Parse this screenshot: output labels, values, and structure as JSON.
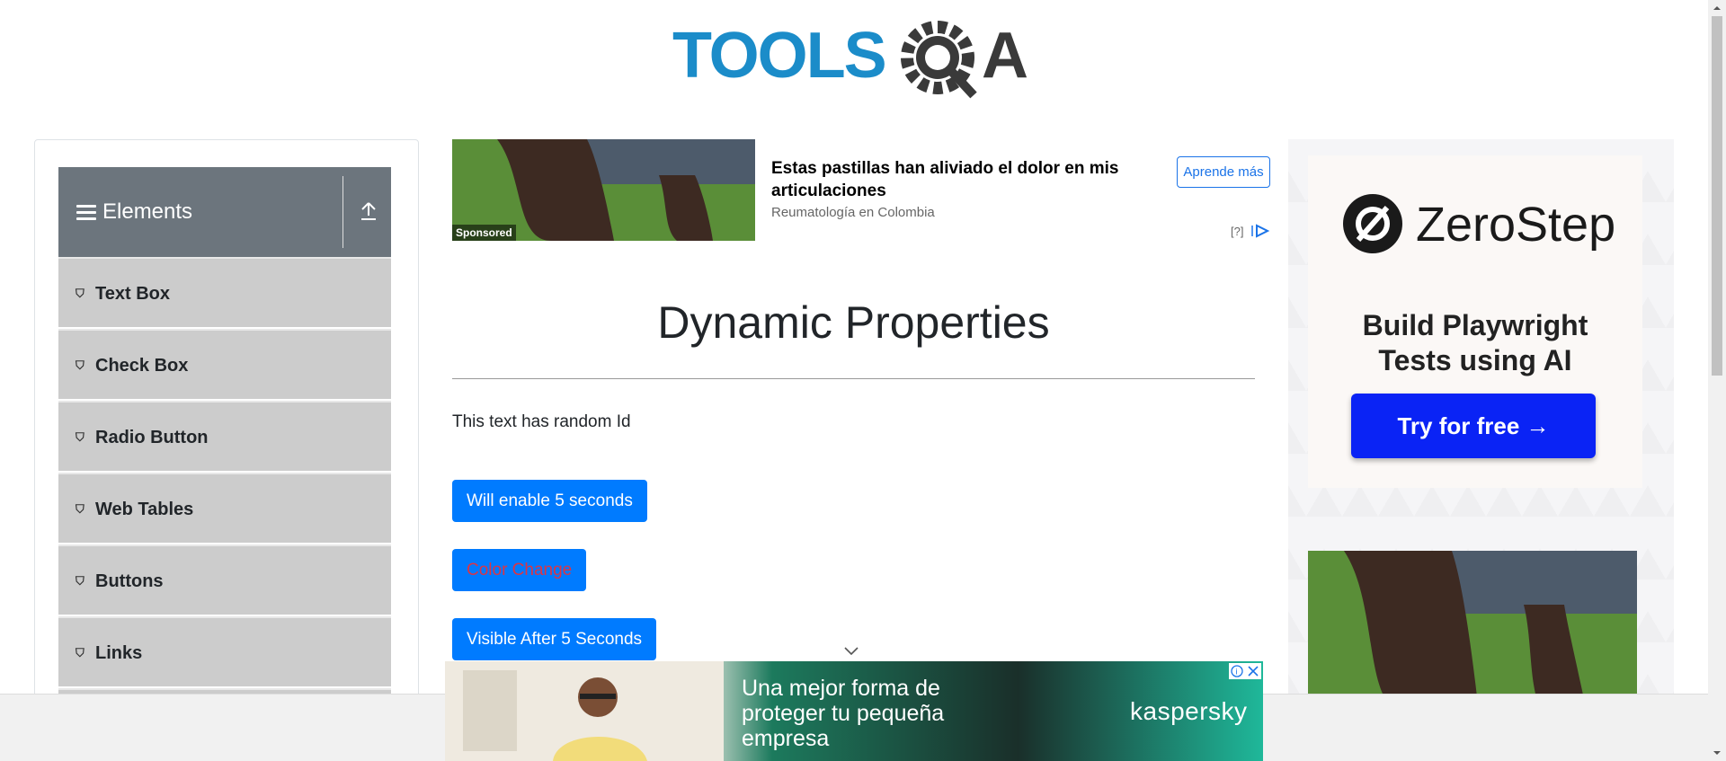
{
  "logo": {
    "brand": "TOOLSQA"
  },
  "sidebar": {
    "group_title": "Elements",
    "items": [
      {
        "label": "Text Box"
      },
      {
        "label": "Check Box"
      },
      {
        "label": "Radio Button"
      },
      {
        "label": "Web Tables"
      },
      {
        "label": "Buttons"
      },
      {
        "label": "Links"
      }
    ]
  },
  "top_ad": {
    "sponsored": "Sponsored",
    "headline": "Estas pastillas han aliviado el dolor en mis articulaciones",
    "source": "Reumatología en Colombia",
    "cta": "Aprende más",
    "help": "[?]"
  },
  "main": {
    "title": "Dynamic Properties",
    "random_text": "This text has random Id",
    "buttons": {
      "enable": "Will enable 5 seconds",
      "color": "Color Change",
      "visible": "Visible After 5 Seconds"
    }
  },
  "right_ad": {
    "brand": "ZeroStep",
    "tagline_1": "Build Playwright",
    "tagline_2": "Tests using AI",
    "cta": "Try for free →"
  },
  "bottom_ad": {
    "text": "Una mejor forma de proteger tu pequeña empresa",
    "brand": "kaspersky"
  },
  "colors": {
    "primary": "#007bff",
    "danger": "#dc3545",
    "sidebar_header": "#6c757d",
    "sidebar_item": "#cccccc",
    "zerostep_blue": "#0a23f5"
  }
}
